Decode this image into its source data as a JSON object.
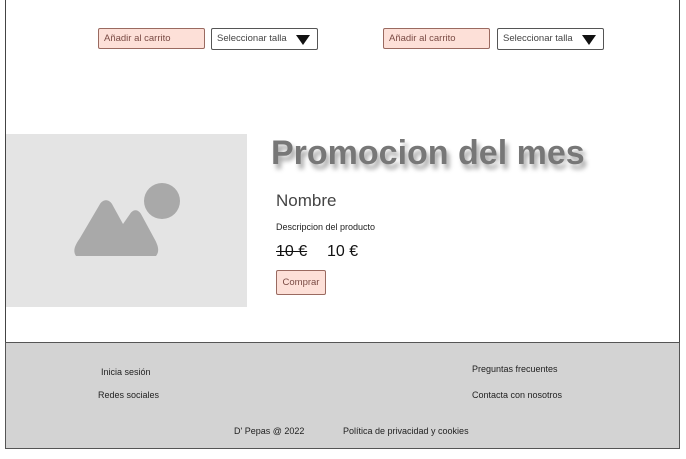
{
  "products": [
    {
      "add_to_cart": "Añadir al carrito",
      "size_select": "Seleccionar talla"
    },
    {
      "add_to_cart": "Añadir al carrito",
      "size_select": "Seleccionar talla"
    }
  ],
  "promo": {
    "title": "Promocion del mes",
    "name": "Nombre",
    "description": "Descripcion del producto",
    "old_price": "10 €",
    "new_price": "10 €",
    "buy_label": "Comprar"
  },
  "footer": {
    "login": "Inicia sesión",
    "social": "Redes sociales",
    "faq": "Preguntas frecuentes",
    "contact": "Contacta con nosotros",
    "copyright": "D' Pepas @ 2022",
    "privacy": "Política de privacidad y cookies"
  },
  "colors": {
    "button_bg": "#fde0d8",
    "footer_bg": "#d3d3d3",
    "placeholder_bg": "#e4e4e4",
    "title_color": "#777777"
  }
}
